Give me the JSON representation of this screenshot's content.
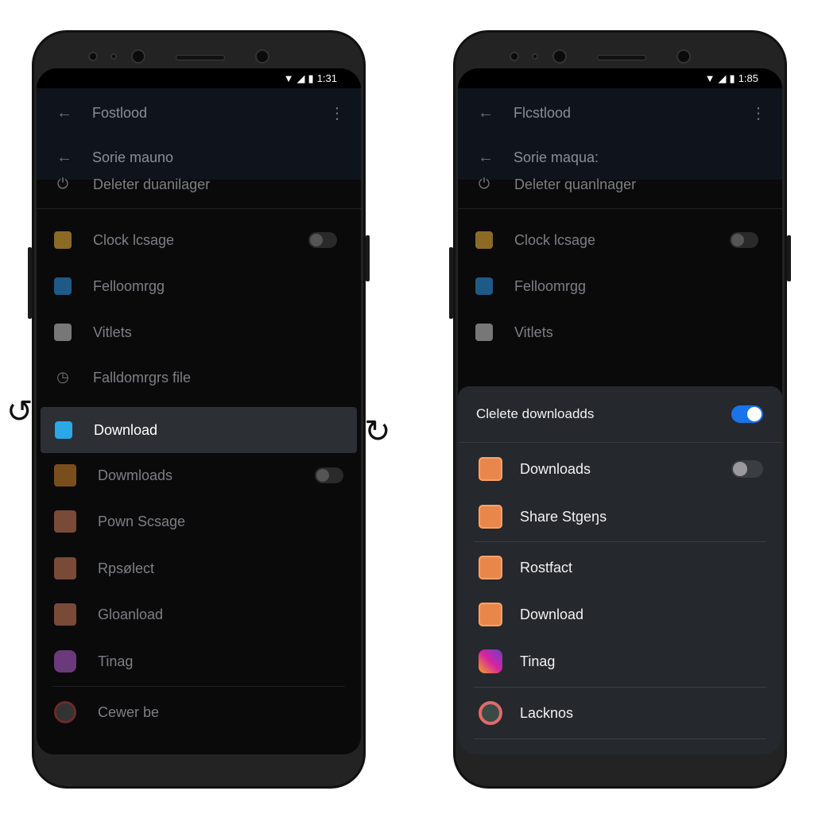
{
  "left_phone": {
    "status": {
      "time": "1:31",
      "icons": [
        "wifi-icon",
        "signal-icon",
        "battery-icon"
      ]
    },
    "header": {
      "title": "Fostlood",
      "subtitle": "Sorie mauno"
    },
    "items": [
      {
        "label": "Deleter duanilager",
        "icon": "power-icon"
      },
      {
        "label": "Clock lcsage",
        "icon": "folder-icon",
        "color": "#8a6a24",
        "toggle": false
      },
      {
        "label": "Felloomrgg",
        "icon": "folder-icon",
        "color": "#1f5a86"
      },
      {
        "label": "Vitlets",
        "icon": "camera-icon",
        "color": "#777777"
      },
      {
        "label": "Falldomrgrs file",
        "icon": "clock-icon"
      }
    ],
    "selected": {
      "label": "Download",
      "icon": "download-icon",
      "color": "#2aa8e8"
    },
    "items2": [
      {
        "label": "Dowmloads",
        "icon": "app-icon",
        "color": "#7a4e1c",
        "toggle": false
      },
      {
        "label": "Pown Scsage",
        "icon": "app-icon",
        "color": "#7a4a38"
      },
      {
        "label": "Rpsølect",
        "icon": "app-icon",
        "color": "#7a4a38"
      },
      {
        "label": "Gloanload",
        "icon": "app-icon",
        "color": "#7a4a38"
      },
      {
        "label": "Tinag",
        "icon": "instagram-icon",
        "color": "#6b3a7a"
      },
      {
        "label": "Cewer be",
        "icon": "circle-app-icon",
        "color": "#6b2b2b"
      }
    ]
  },
  "right_phone": {
    "status": {
      "time": "1:85",
      "icons": [
        "wifi-icon",
        "signal-icon",
        "battery-icon"
      ]
    },
    "header": {
      "title": "Flcstlood",
      "subtitle": "Sorie maqua:"
    },
    "items": [
      {
        "label": "Deleter quanlnager",
        "icon": "power-icon"
      },
      {
        "label": "Clock lcsage",
        "icon": "folder-icon",
        "color": "#8a6a24",
        "toggle": false
      },
      {
        "label": "Felloomrgg",
        "icon": "folder-icon",
        "color": "#1f5a86"
      },
      {
        "label": "Vitlets",
        "icon": "camera-icon",
        "color": "#777777"
      }
    ],
    "sheet": {
      "title": "Clelete downloadds",
      "title_toggle": true,
      "accent": "#1a73e8",
      "items": [
        {
          "label": "Downloads",
          "icon": "download-app-icon",
          "toggle": false
        },
        {
          "label": "Share Stgeŋs",
          "icon": "share-app-icon"
        },
        {
          "label": "Rostfact",
          "icon": "document-app-icon"
        },
        {
          "label": "Download",
          "icon": "download-app-icon"
        },
        {
          "label": "Tinag",
          "icon": "instagram-icon"
        },
        {
          "label": "Lacknos",
          "icon": "circle-app-icon"
        }
      ]
    }
  }
}
